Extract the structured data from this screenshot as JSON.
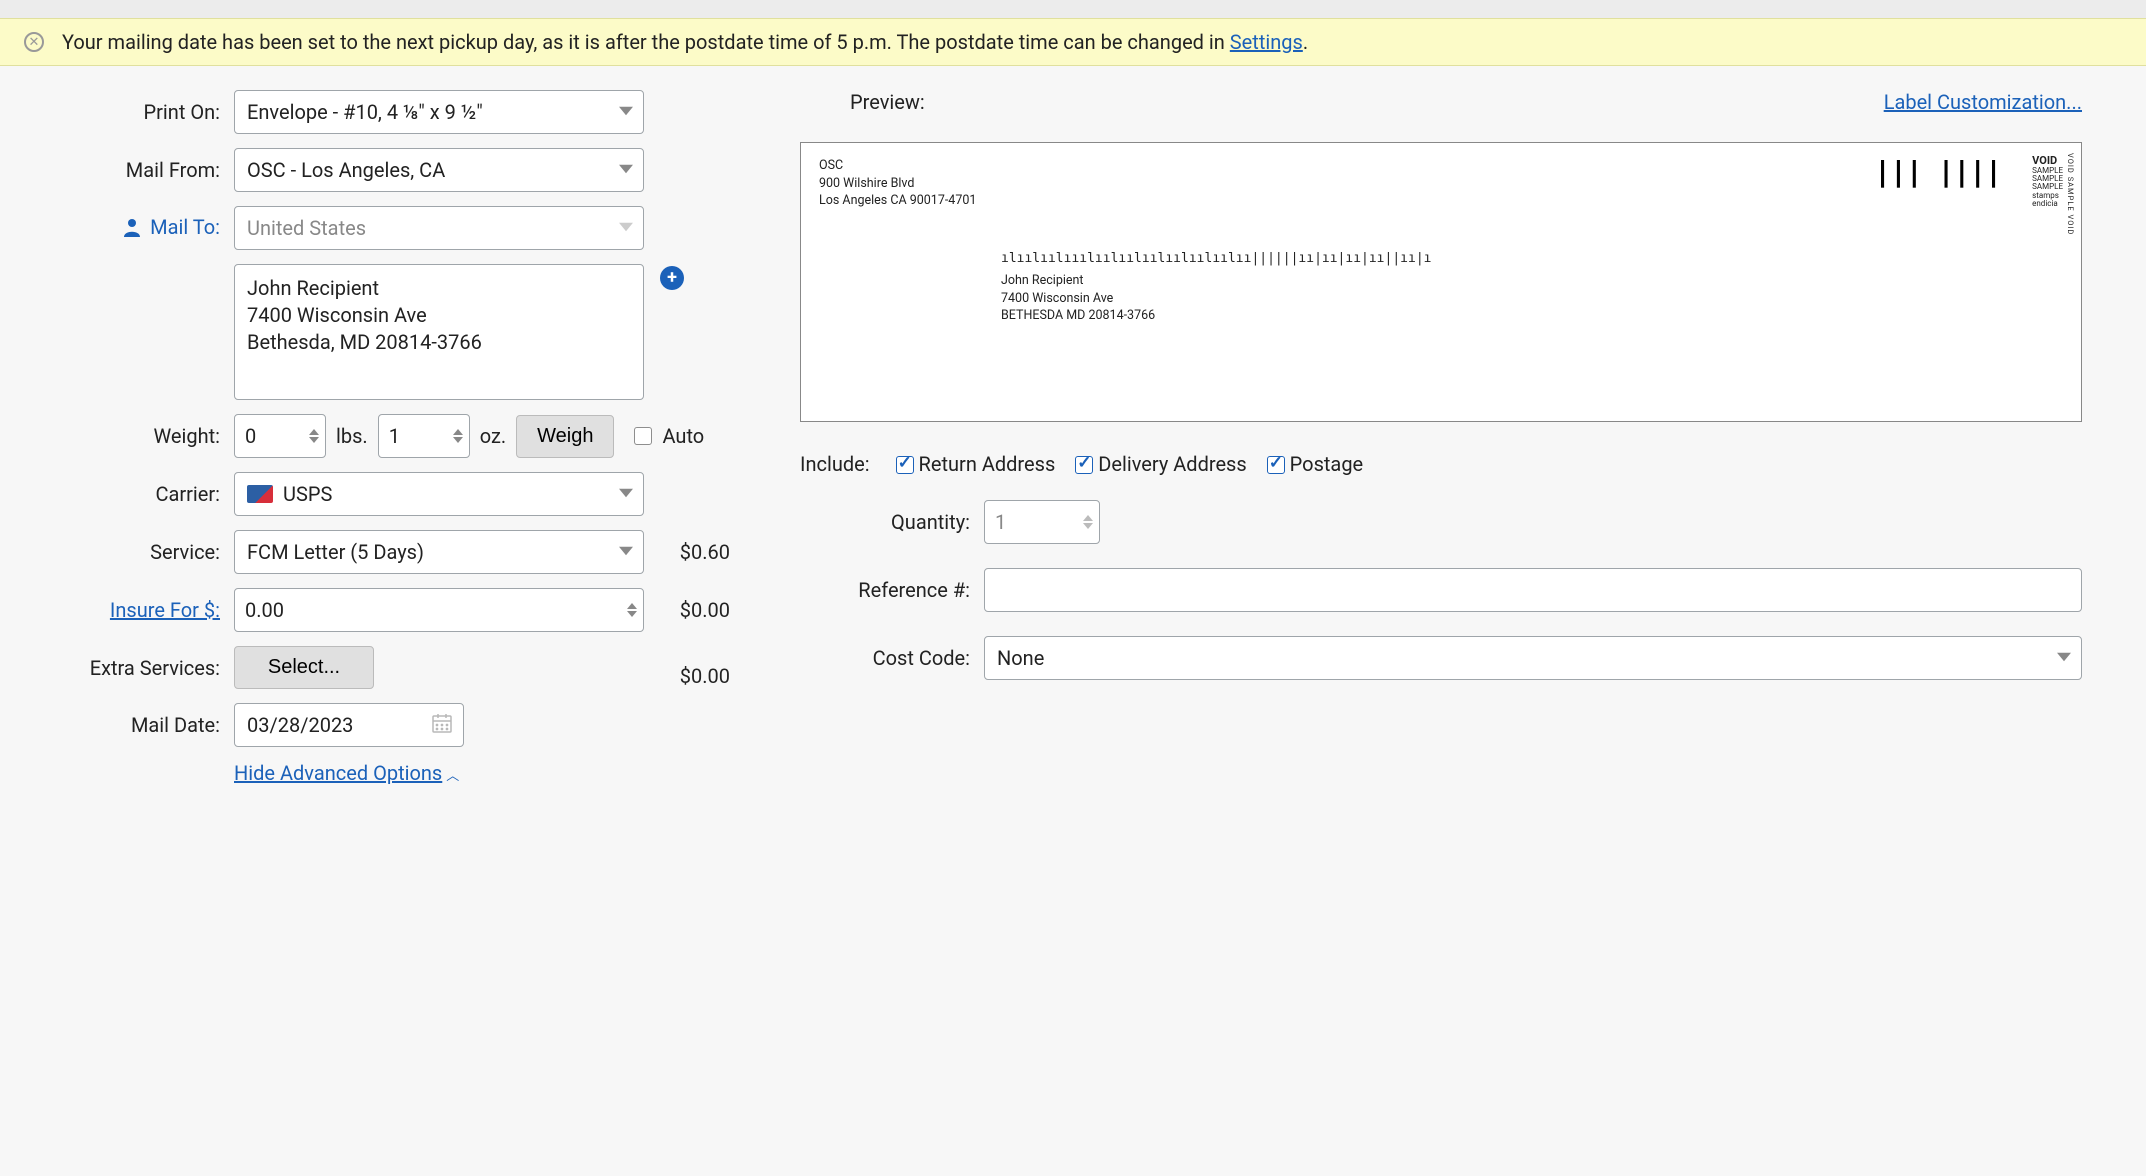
{
  "banner": {
    "message": "Your mailing date has been set to the next pickup day, as it is after the postdate time of 5 p.m. The postdate time can be changed in ",
    "link_text": "Settings",
    "period": "."
  },
  "form": {
    "print_on": {
      "label": "Print On:",
      "value": "Envelope - #10, 4 ⅛\" x 9 ½\""
    },
    "mail_from": {
      "label": "Mail From:",
      "value": "OSC - Los Angeles, CA"
    },
    "mail_to": {
      "label": "Mail To:",
      "country": "United States",
      "address": "John Recipient\n7400 Wisconsin Ave\nBethesda, MD 20814-3766"
    },
    "weight": {
      "label": "Weight:",
      "lbs": "0",
      "lbs_unit": "lbs.",
      "oz": "1",
      "oz_unit": "oz.",
      "weigh_btn": "Weigh",
      "auto": "Auto"
    },
    "carrier": {
      "label": "Carrier:",
      "value": "USPS"
    },
    "service": {
      "label": "Service:",
      "value": "FCM Letter (5 Days)",
      "price": "$0.60"
    },
    "insure": {
      "label": "Insure For $:",
      "value": "0.00",
      "price": "$0.00"
    },
    "extra": {
      "label": "Extra Services:",
      "btn": "Select...",
      "price": "$0.00"
    },
    "mail_date": {
      "label": "Mail Date:",
      "value": "03/28/2023"
    },
    "adv_link": "Hide Advanced Options"
  },
  "preview": {
    "label": "Preview:",
    "customization_link": "Label Customization...",
    "return_addr": "OSC\n900 Wilshire Blvd\nLos Angeles CA 90017-4701",
    "void_big": "VOID",
    "sample": "SAMPLE",
    "stamps": "stamps\nendicia",
    "void_side": "VOID SAMPLE VOID",
    "imb": "ılıılıılııılıılıılıılıılıılıılıı||||||ıı|ıı|ıı|ıı||ıı|ı",
    "dest_addr": "John Recipient\n7400 Wisconsin Ave\nBETHESDA MD 20814-3766"
  },
  "include": {
    "label": "Include:",
    "return_address": "Return Address",
    "delivery_address": "Delivery Address",
    "postage": "Postage"
  },
  "right_form": {
    "quantity": {
      "label": "Quantity:",
      "value": "1"
    },
    "reference": {
      "label": "Reference #:"
    },
    "cost_code": {
      "label": "Cost Code:",
      "value": "None"
    }
  }
}
